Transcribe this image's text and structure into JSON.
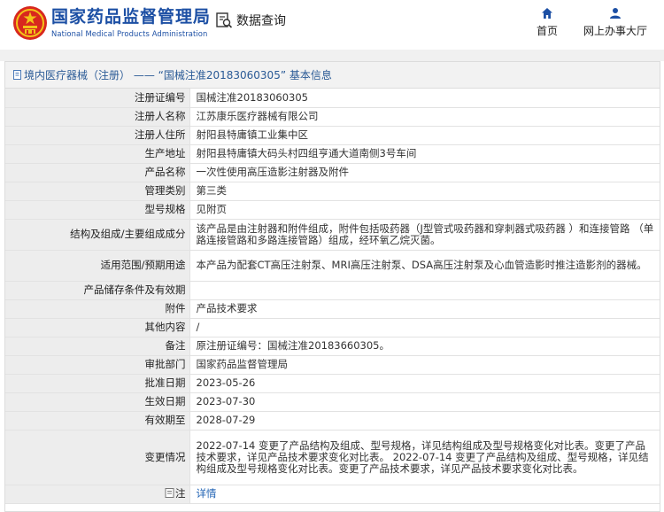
{
  "header": {
    "site_title_cn": "国家药品监督管理局",
    "site_title_en": "National Medical Products Administration",
    "search_label": "数据查询",
    "nav_home": "首页",
    "nav_service": "网上办事大厅"
  },
  "breadcrumb": {
    "text": "境内医疗器械（注册） —— “国械注准20183060305” 基本信息"
  },
  "fields": [
    {
      "label": "注册证编号",
      "value": "国械注准20183060305"
    },
    {
      "label": "注册人名称",
      "value": "江苏康乐医疗器械有限公司"
    },
    {
      "label": "注册人住所",
      "value": "射阳县特庸镇工业集中区"
    },
    {
      "label": "生产地址",
      "value": "射阳县特庸镇大码头村四组亨通大道南侧3号车间"
    },
    {
      "label": "产品名称",
      "value": "一次性使用高压造影注射器及附件"
    },
    {
      "label": "管理类别",
      "value": "第三类"
    },
    {
      "label": "型号规格",
      "value": "见附页"
    },
    {
      "label": "结构及组成/主要组成成分",
      "value": "该产品是由注射器和附件组成，附件包括吸药器（J型管式吸药器和穿刺器式吸药器 ）和连接管路 （单路连接管路和多路连接管路）组成，经环氧乙烷灭菌。"
    },
    {
      "label": "适用范围/预期用途",
      "value": "本产品为配套CT高压注射泵、MRI高压注射泵、DSA高压注射泵及心血管造影时推注造影剂的器械。"
    },
    {
      "label": "产品储存条件及有效期",
      "value": ""
    },
    {
      "label": "附件",
      "value": "产品技术要求"
    },
    {
      "label": "其他内容",
      "value": "/"
    },
    {
      "label": "备注",
      "value": "原注册证编号：国械注准20183660305。"
    },
    {
      "label": "审批部门",
      "value": "国家药品监督管理局"
    },
    {
      "label": "批准日期",
      "value": "2023-05-26"
    },
    {
      "label": "生效日期",
      "value": "2023-07-30"
    },
    {
      "label": "有效期至",
      "value": "2028-07-29"
    },
    {
      "label": "变更情况",
      "value": "2022-07-14 变更了产品结构及组成、型号规格，详见结构组成及型号规格变化对比表。变更了产品技术要求，详见产品技术要求变化对比表。 2022-07-14 变更了产品结构及组成、型号规格，详见结构组成及型号规格变化对比表。变更了产品技术要求，详见产品技术要求变化对比表。"
    }
  ],
  "note": {
    "label": "注",
    "link": "详情"
  },
  "colors": {
    "brand_blue": "#1c4fa4",
    "label_bg": "#ededed",
    "link_blue": "#1a5eb2"
  }
}
